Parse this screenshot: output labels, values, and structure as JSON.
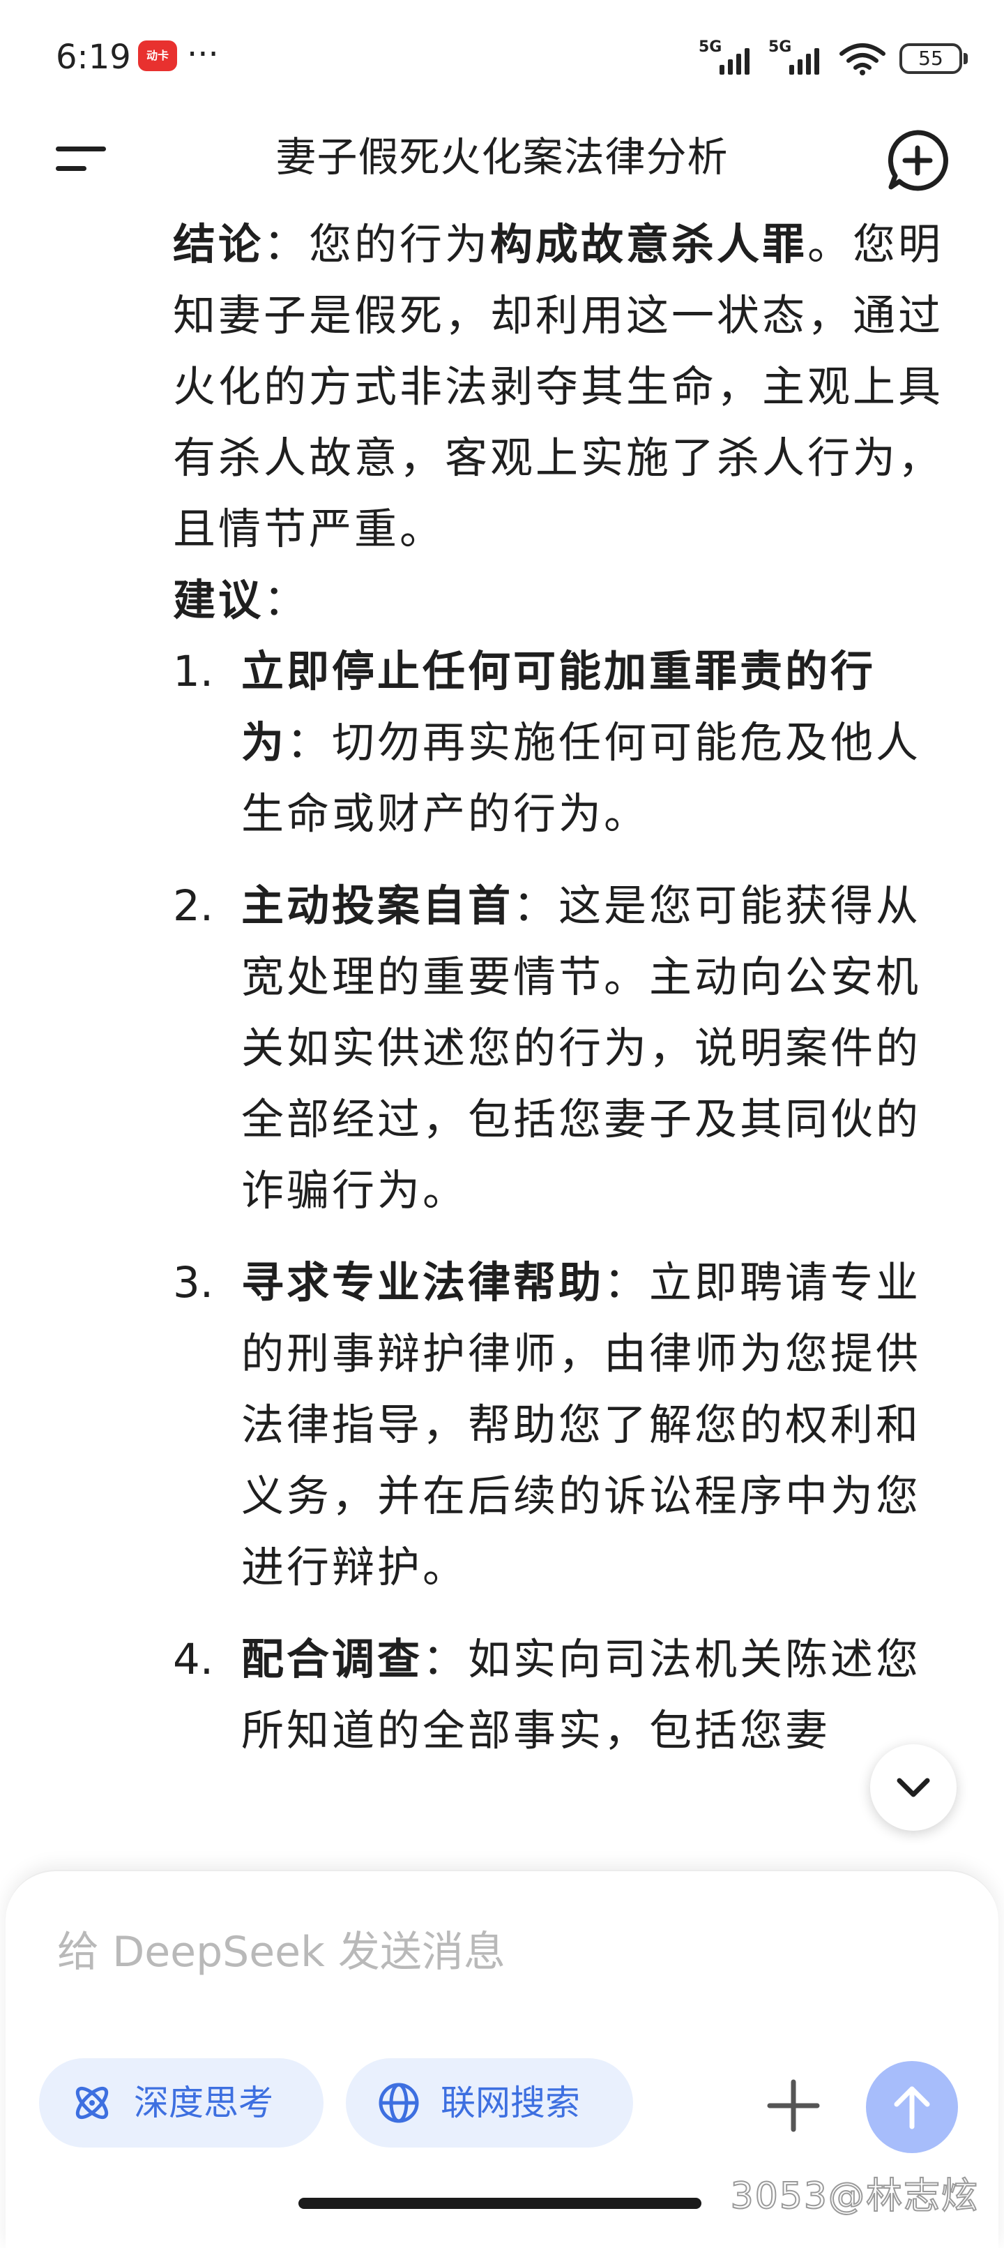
{
  "status_bar": {
    "time": "6:19",
    "app_badge": "动卡",
    "more": "···",
    "signal1_label": "5G",
    "signal2_label": "5G",
    "battery": "55"
  },
  "header": {
    "title": "妻子假死火化案法律分析"
  },
  "content": {
    "conclusion_label": "结论",
    "conclusion_sep": "：您的行为",
    "conclusion_bold": "构成故意杀人罪",
    "conclusion_rest": "。您明知妻子是假死，却利用这一状态，通过火化的方式非法剥夺其生命，主观上具有杀人故意，客观上实施了杀人行为，且情节严重。",
    "suggest_label": "建议",
    "suggest_sep": "：",
    "items": [
      {
        "num": "1.",
        "title": "立即停止任何可能加重罪责的行为",
        "text": "：切勿再实施任何可能危及他人生命或财产的行为。"
      },
      {
        "num": "2.",
        "title": "主动投案自首",
        "text": "：这是您可能获得从宽处理的重要情节。主动向公安机关如实供述您的行为，说明案件的全部经过，包括您妻子及其同伙的诈骗行为。"
      },
      {
        "num": "3.",
        "title": "寻求专业法律帮助",
        "text": "：立即聘请专业的刑事辩护律师，由律师为您提供法律指导，帮助您了解您的权利和义务，并在后续的诉讼程序中为您进行辩护。"
      },
      {
        "num": "4.",
        "title": "配合调查",
        "text": "：如实向司法机关陈述您所知道的全部事实，包括您妻"
      }
    ]
  },
  "composer": {
    "placeholder": "给 DeepSeek 发送消息",
    "deep_think_label": "深度思考",
    "web_search_label": "联网搜索"
  },
  "watermark": "3053@林志炫",
  "colors": {
    "accent": "#3d6fe0",
    "chip_bg": "#e9f0fd",
    "send_button": "#a7bdfb"
  }
}
